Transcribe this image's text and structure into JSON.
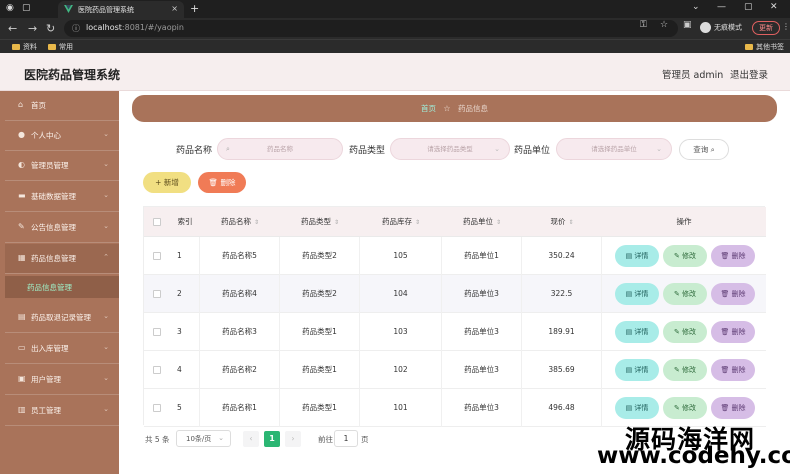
{
  "browser": {
    "tab_title": "医院药品管理系统",
    "url_host": "localhost",
    "url_rest": ":8081/#/yaopin",
    "incognito_label": "无痕模式",
    "update_label": "更新",
    "bookmarks": [
      "资料",
      "常用"
    ],
    "other_bookmarks": "其他书签"
  },
  "header": {
    "title": "医院药品管理系统",
    "admin": "管理员 admin",
    "logout": "退出登录"
  },
  "sidebar": {
    "items": [
      {
        "label": "首页",
        "icon": "home-icon"
      },
      {
        "label": "个人中心",
        "icon": "user-icon"
      },
      {
        "label": "管理员管理",
        "icon": "admin-icon"
      },
      {
        "label": "基础数据管理",
        "icon": "data-icon"
      },
      {
        "label": "公告信息管理",
        "icon": "notice-icon"
      },
      {
        "label": "药品信息管理",
        "icon": "drug-icon"
      },
      {
        "label": "药品取退记录管理",
        "icon": "record-icon"
      },
      {
        "label": "出入库管理",
        "icon": "warehouse-icon"
      },
      {
        "label": "用户管理",
        "icon": "users-icon"
      },
      {
        "label": "员工管理",
        "icon": "staff-icon"
      }
    ],
    "active_sub": "药品信息管理"
  },
  "breadcrumb": {
    "home": "首页",
    "current": "药品信息"
  },
  "search": {
    "name_label": "药品名称",
    "name_placeholder": "药品名称",
    "type_label": "药品类型",
    "type_placeholder": "请选择药品类型",
    "unit_label": "药品单位",
    "unit_placeholder": "请选择药品单位",
    "query_label": "查询"
  },
  "actions": {
    "add_label": "新增",
    "delete_label": "删除"
  },
  "table": {
    "headers": [
      "索引",
      "药品名称",
      "药品类型",
      "药品库存",
      "药品单位",
      "现价",
      "操作"
    ],
    "rows": [
      {
        "index": "1",
        "name": "药品名称5",
        "type": "药品类型2",
        "stock": "105",
        "unit": "药品单位1",
        "price": "350.24"
      },
      {
        "index": "2",
        "name": "药品名称4",
        "type": "药品类型2",
        "stock": "104",
        "unit": "药品单位3",
        "price": "322.5"
      },
      {
        "index": "3",
        "name": "药品名称3",
        "type": "药品类型1",
        "stock": "103",
        "unit": "药品单位3",
        "price": "189.91"
      },
      {
        "index": "4",
        "name": "药品名称2",
        "type": "药品类型1",
        "stock": "102",
        "unit": "药品单位3",
        "price": "385.69"
      },
      {
        "index": "5",
        "name": "药品名称1",
        "type": "药品类型1",
        "stock": "101",
        "unit": "药品单位3",
        "price": "496.48"
      }
    ],
    "op_detail": "详情",
    "op_edit": "修改",
    "op_delete": "删除"
  },
  "pagination": {
    "total": "共 5 条",
    "page_size": "10条/页",
    "current_page": "1",
    "goto_label": "前往",
    "goto_value": "1",
    "page_label": "页"
  },
  "watermark": {
    "line1": "源码海洋网",
    "line2": "www.codehy.com"
  }
}
